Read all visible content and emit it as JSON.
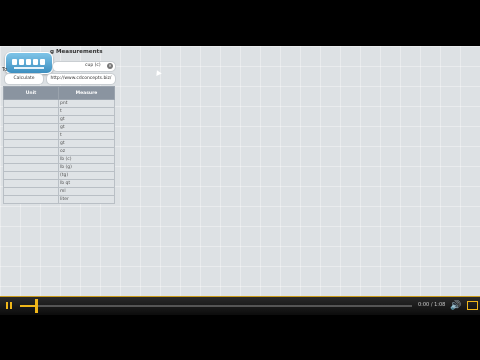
{
  "app": {
    "title": "g Measurements",
    "to_label": "To",
    "to_value": "cup (c)",
    "calculate_label": "Calculate",
    "url": "http://www.cdconcepts.biz/"
  },
  "table": {
    "headers": [
      "Unit",
      "Measure"
    ],
    "rows": [
      [
        "",
        "pnt"
      ],
      [
        "",
        "t"
      ],
      [
        "",
        "gt"
      ],
      [
        "",
        "gt"
      ],
      [
        "",
        "t"
      ],
      [
        "",
        "gt"
      ],
      [
        "",
        "oz"
      ],
      [
        "",
        "lb (c)"
      ],
      [
        "",
        "lb (g)"
      ],
      [
        "",
        "(tg)"
      ],
      [
        "",
        "lb qt"
      ],
      [
        "",
        "ml"
      ],
      [
        "",
        "liter"
      ]
    ]
  },
  "player": {
    "time": "0:00 / 1:08",
    "progress": 0.04,
    "colors": {
      "accent": "#f0b71a"
    }
  },
  "icons": [
    "pause-icon",
    "volume-icon",
    "fullscreen-icon",
    "clear-icon",
    "logo"
  ]
}
